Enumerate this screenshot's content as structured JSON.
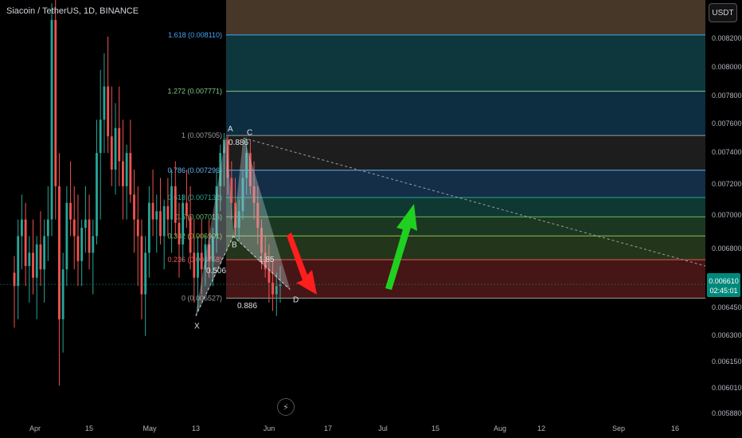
{
  "header": {
    "title": "Siacoin / TetherUS, 1D, BINANCE"
  },
  "unit_label": "USDT",
  "colors": {
    "up": "#26a69a",
    "down": "#ef5350",
    "price_label": "#00897b"
  },
  "chart_data": {
    "type": "candlestick",
    "title": "Siacoin / TetherUS, 1D, BINANCE",
    "ylim": [
      0.00582,
      0.00832
    ],
    "y_ticks": [
      "0.008200",
      "0.008000",
      "0.007800",
      "0.007600",
      "0.007400",
      "0.007200",
      "0.007000",
      "0.006800",
      "0.006450",
      "0.006300",
      "0.006150",
      "0.006010",
      "0.005880"
    ],
    "x_ticks": [
      "Apr",
      "15",
      "May",
      "13",
      "Jun",
      "17",
      "Jul",
      "15",
      "Aug",
      "12",
      "Sep",
      "16"
    ],
    "current_price": "0.006610",
    "countdown": "02:45:01",
    "fib_levels": [
      {
        "ratio": "1.618",
        "price": 0.00811,
        "label": "1.618 (0.008110)",
        "color": "#42a5f5"
      },
      {
        "ratio": "1.272",
        "price": 0.007771,
        "label": "1.272 (0.007771)",
        "color": "#81c784"
      },
      {
        "ratio": "1",
        "price": 0.007505,
        "label": "1 (0.007505)",
        "color": "#9e9e9e"
      },
      {
        "ratio": "0.786",
        "price": 0.007296,
        "label": "0.786 (0.007296)",
        "color": "#64b5f6"
      },
      {
        "ratio": "0.618",
        "price": 0.007132,
        "label": "0.618 (0.007132)",
        "color": "#26a69a"
      },
      {
        "ratio": "0.5",
        "price": 0.007016,
        "label": "0.5 (0.007016)",
        "color": "#66bb6a"
      },
      {
        "ratio": "0.382",
        "price": 0.006901,
        "label": "0.382 (0.006901)",
        "color": "#8bc34a"
      },
      {
        "ratio": "0.236",
        "price": 0.006758,
        "label": "0.236 (0.006758)",
        "color": "#ef5350"
      },
      {
        "ratio": "0",
        "price": 0.006527,
        "label": "0 (0.006527)",
        "color": "#9e9e9e"
      }
    ],
    "pattern_points": [
      {
        "name": "X",
        "price": 0.00642
      },
      {
        "name": "A",
        "price": 0.0075
      },
      {
        "name": "B",
        "price": 0.0069
      },
      {
        "name": "C",
        "price": 0.00749
      },
      {
        "name": "D",
        "price": 0.00658
      }
    ],
    "pattern_ratios": [
      "0.886",
      "0.506",
      "1.85",
      "0.886"
    ],
    "candles": [
      {
        "o": 0.00668,
        "h": 0.00678,
        "l": 0.00635,
        "c": 0.0066
      },
      {
        "o": 0.0066,
        "h": 0.007,
        "l": 0.0064,
        "c": 0.0069
      },
      {
        "o": 0.0069,
        "h": 0.00715,
        "l": 0.0067,
        "c": 0.007
      },
      {
        "o": 0.007,
        "h": 0.0071,
        "l": 0.0066,
        "c": 0.00672
      },
      {
        "o": 0.00672,
        "h": 0.0069,
        "l": 0.0065,
        "c": 0.0068
      },
      {
        "o": 0.0068,
        "h": 0.007,
        "l": 0.00655,
        "c": 0.00665
      },
      {
        "o": 0.00665,
        "h": 0.0069,
        "l": 0.0064,
        "c": 0.00685
      },
      {
        "o": 0.00685,
        "h": 0.00705,
        "l": 0.0066,
        "c": 0.0067
      },
      {
        "o": 0.0067,
        "h": 0.007,
        "l": 0.0065,
        "c": 0.0069
      },
      {
        "o": 0.0069,
        "h": 0.0072,
        "l": 0.00675,
        "c": 0.007
      },
      {
        "o": 0.007,
        "h": 0.0083,
        "l": 0.0069,
        "c": 0.0082
      },
      {
        "o": 0.0082,
        "h": 0.00832,
        "l": 0.007,
        "c": 0.0072
      },
      {
        "o": 0.0072,
        "h": 0.0074,
        "l": 0.006,
        "c": 0.0064
      },
      {
        "o": 0.0064,
        "h": 0.0068,
        "l": 0.0062,
        "c": 0.0067
      },
      {
        "o": 0.0067,
        "h": 0.0072,
        "l": 0.0066,
        "c": 0.0071
      },
      {
        "o": 0.0071,
        "h": 0.00735,
        "l": 0.0069,
        "c": 0.007
      },
      {
        "o": 0.007,
        "h": 0.0072,
        "l": 0.0067,
        "c": 0.0069
      },
      {
        "o": 0.0069,
        "h": 0.00715,
        "l": 0.0066,
        "c": 0.00675
      },
      {
        "o": 0.00675,
        "h": 0.007,
        "l": 0.0066,
        "c": 0.00695
      },
      {
        "o": 0.00695,
        "h": 0.0072,
        "l": 0.0068,
        "c": 0.007
      },
      {
        "o": 0.007,
        "h": 0.00715,
        "l": 0.0067,
        "c": 0.0068
      },
      {
        "o": 0.0068,
        "h": 0.007,
        "l": 0.00655,
        "c": 0.0069
      },
      {
        "o": 0.0069,
        "h": 0.0076,
        "l": 0.00685,
        "c": 0.0074
      },
      {
        "o": 0.0074,
        "h": 0.0079,
        "l": 0.007,
        "c": 0.0076
      },
      {
        "o": 0.0076,
        "h": 0.008,
        "l": 0.0074,
        "c": 0.0078
      },
      {
        "o": 0.0078,
        "h": 0.0081,
        "l": 0.0074,
        "c": 0.0075
      },
      {
        "o": 0.0075,
        "h": 0.0078,
        "l": 0.0072,
        "c": 0.0073
      },
      {
        "o": 0.0073,
        "h": 0.0077,
        "l": 0.00715,
        "c": 0.00755
      },
      {
        "o": 0.00755,
        "h": 0.0078,
        "l": 0.0072,
        "c": 0.00735
      },
      {
        "o": 0.00735,
        "h": 0.0076,
        "l": 0.007,
        "c": 0.0072
      },
      {
        "o": 0.0072,
        "h": 0.00745,
        "l": 0.007,
        "c": 0.0074
      },
      {
        "o": 0.0074,
        "h": 0.0076,
        "l": 0.0071,
        "c": 0.00715
      },
      {
        "o": 0.00715,
        "h": 0.0073,
        "l": 0.0068,
        "c": 0.007
      },
      {
        "o": 0.007,
        "h": 0.0072,
        "l": 0.0066,
        "c": 0.0069
      },
      {
        "o": 0.0069,
        "h": 0.007,
        "l": 0.0064,
        "c": 0.00655
      },
      {
        "o": 0.00655,
        "h": 0.0069,
        "l": 0.0063,
        "c": 0.0068
      },
      {
        "o": 0.0068,
        "h": 0.0072,
        "l": 0.00665,
        "c": 0.0071
      },
      {
        "o": 0.0071,
        "h": 0.0073,
        "l": 0.0069,
        "c": 0.007
      },
      {
        "o": 0.007,
        "h": 0.00715,
        "l": 0.0068,
        "c": 0.00705
      },
      {
        "o": 0.00705,
        "h": 0.00725,
        "l": 0.00685,
        "c": 0.0069
      },
      {
        "o": 0.0069,
        "h": 0.00712,
        "l": 0.0067,
        "c": 0.00708
      },
      {
        "o": 0.00708,
        "h": 0.00725,
        "l": 0.0069,
        "c": 0.007
      },
      {
        "o": 0.007,
        "h": 0.0073,
        "l": 0.0068,
        "c": 0.0072
      },
      {
        "o": 0.0072,
        "h": 0.00735,
        "l": 0.0069,
        "c": 0.00698
      },
      {
        "o": 0.00698,
        "h": 0.0071,
        "l": 0.00665,
        "c": 0.00685
      },
      {
        "o": 0.00685,
        "h": 0.00715,
        "l": 0.00675,
        "c": 0.0071
      },
      {
        "o": 0.0071,
        "h": 0.0073,
        "l": 0.00695,
        "c": 0.00702
      },
      {
        "o": 0.00702,
        "h": 0.0072,
        "l": 0.0067,
        "c": 0.0068
      },
      {
        "o": 0.0068,
        "h": 0.007,
        "l": 0.0065,
        "c": 0.00665
      },
      {
        "o": 0.00665,
        "h": 0.0069,
        "l": 0.00645,
        "c": 0.0068
      },
      {
        "o": 0.0068,
        "h": 0.007,
        "l": 0.00655,
        "c": 0.0067
      },
      {
        "o": 0.0067,
        "h": 0.0069,
        "l": 0.0066,
        "c": 0.00685
      },
      {
        "o": 0.00685,
        "h": 0.007,
        "l": 0.00665,
        "c": 0.00675
      },
      {
        "o": 0.00675,
        "h": 0.00695,
        "l": 0.0066,
        "c": 0.0069
      },
      {
        "o": 0.0069,
        "h": 0.0073,
        "l": 0.0068,
        "c": 0.0072
      },
      {
        "o": 0.0072,
        "h": 0.00745,
        "l": 0.00705,
        "c": 0.0074
      },
      {
        "o": 0.0074,
        "h": 0.00752,
        "l": 0.0072,
        "c": 0.00748
      },
      {
        "o": 0.00748,
        "h": 0.0075,
        "l": 0.00715,
        "c": 0.00725
      },
      {
        "o": 0.00725,
        "h": 0.00735,
        "l": 0.007,
        "c": 0.0071
      },
      {
        "o": 0.0071,
        "h": 0.00725,
        "l": 0.0069,
        "c": 0.00695
      },
      {
        "o": 0.00695,
        "h": 0.00712,
        "l": 0.00688,
        "c": 0.00705
      },
      {
        "o": 0.00705,
        "h": 0.0073,
        "l": 0.007,
        "c": 0.00725
      },
      {
        "o": 0.00725,
        "h": 0.00749,
        "l": 0.00715,
        "c": 0.0074
      },
      {
        "o": 0.0074,
        "h": 0.00748,
        "l": 0.00715,
        "c": 0.0072
      },
      {
        "o": 0.0072,
        "h": 0.00735,
        "l": 0.007,
        "c": 0.0071
      },
      {
        "o": 0.0071,
        "h": 0.0072,
        "l": 0.00685,
        "c": 0.00695
      },
      {
        "o": 0.00695,
        "h": 0.007,
        "l": 0.0067,
        "c": 0.0068
      },
      {
        "o": 0.0068,
        "h": 0.0069,
        "l": 0.00665,
        "c": 0.0067
      },
      {
        "o": 0.0067,
        "h": 0.00685,
        "l": 0.0065,
        "c": 0.00662
      },
      {
        "o": 0.00662,
        "h": 0.00675,
        "l": 0.00645,
        "c": 0.00655
      },
      {
        "o": 0.00655,
        "h": 0.00668,
        "l": 0.00642,
        "c": 0.0066
      },
      {
        "o": 0.0066,
        "h": 0.00672,
        "l": 0.0065,
        "c": 0.00661
      }
    ]
  }
}
